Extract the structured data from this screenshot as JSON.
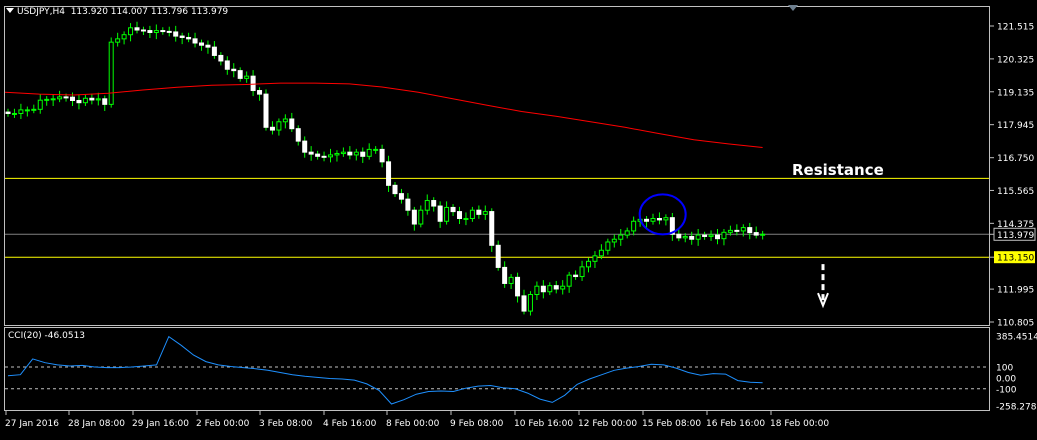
{
  "header": {
    "symbol": "USDJPY,H4",
    "ohlc": "113.920 114.007 113.796 113.979",
    "cci_label": "CCI(20) -46.0513"
  },
  "colors": {
    "background": "#000000",
    "grid": "#ffffff",
    "bull_candle": "#ffffff",
    "bear_candle": "#00ff00",
    "ma": "#ff0000",
    "level": "#ffff00",
    "cci": "#1e90ff",
    "circle": "#0000ff",
    "price_tag": "#ffff00"
  },
  "annotations": {
    "resistance_label": "Resistance",
    "levels": [
      "116.000",
      "113.150"
    ],
    "current_price": "113.979",
    "arrow": "down-arrow-icon",
    "circle": "blue-ellipse"
  },
  "chart_data": [
    {
      "type": "candlestick",
      "symbol": "USDJPY",
      "timeframe": "H4",
      "ylim": [
        110.805,
        121.515
      ],
      "y_ticks": [
        "121.515",
        "120.325",
        "119.135",
        "117.945",
        "116.750",
        "115.565",
        "114.375",
        "113.979",
        "113.150",
        "111.995",
        "110.805"
      ],
      "x_ticks": [
        "27 Jan 2016",
        "28 Jan 08:00",
        "29 Jan 16:00",
        "2 Feb 00:00",
        "3 Feb 08:00",
        "4 Feb 16:00",
        "8 Feb 00:00",
        "9 Feb 08:00",
        "10 Feb 16:00",
        "12 Feb 00:00",
        "15 Feb 08:00",
        "16 Feb 16:00",
        "18 Feb 00:00"
      ],
      "close_series": [
        118.35,
        118.35,
        118.48,
        118.48,
        118.5,
        118.83,
        118.86,
        118.88,
        118.95,
        118.94,
        118.82,
        118.74,
        118.9,
        118.84,
        118.88,
        118.68,
        120.93,
        121.05,
        121.2,
        121.45,
        121.37,
        121.35,
        121.28,
        121.35,
        121.32,
        121.3,
        121.15,
        121.1,
        121.05,
        120.9,
        120.82,
        120.75,
        120.45,
        120.25,
        119.95,
        119.9,
        119.62,
        119.7,
        119.18,
        119.05,
        117.85,
        117.75,
        118.05,
        118.15,
        117.8,
        117.35,
        116.95,
        116.88,
        116.8,
        116.78,
        116.85,
        116.9,
        116.95,
        116.85,
        116.95,
        116.8,
        117.05,
        117.05,
        116.6,
        115.75,
        115.45,
        115.25,
        114.85,
        114.35,
        114.85,
        115.2,
        115.0,
        114.45,
        114.95,
        114.8,
        114.55,
        114.55,
        114.85,
        114.7,
        114.8,
        113.58,
        112.78,
        112.2,
        112.42,
        111.75,
        111.2,
        111.8,
        112.1,
        111.9,
        112.12,
        112.0,
        112.1,
        112.5,
        112.45,
        112.8,
        113.0,
        113.2,
        113.4,
        113.7,
        113.8,
        113.95,
        114.1,
        114.45,
        114.52,
        114.45,
        114.55,
        114.5,
        114.58,
        113.98,
        113.85,
        113.9,
        113.8,
        113.95,
        113.9,
        113.95,
        113.82,
        114.05,
        114.12,
        114.1,
        114.22,
        114.04,
        113.95,
        113.98
      ],
      "moving_average": {
        "color": "#ff0000",
        "values": [
          119.12,
          119.05,
          119.02,
          119.08,
          119.2,
          119.3,
          119.37,
          119.4,
          119.45,
          119.45,
          119.42,
          119.3,
          119.12,
          118.88,
          118.65,
          118.42,
          118.25,
          118.05,
          117.85,
          117.62,
          117.4,
          117.25,
          117.12
        ]
      },
      "horizontal_levels": [
        {
          "value": 116.0,
          "label": "116.000",
          "color": "#ffff00"
        },
        {
          "value": 113.15,
          "label": "113.150",
          "color": "#ffff00"
        },
        {
          "value": 113.979,
          "label": "113.979",
          "color": "#808080"
        }
      ],
      "annotations": [
        "Resistance"
      ]
    },
    {
      "type": "line",
      "indicator": "CCI(20)",
      "current": -46.0513,
      "ylim": [
        -258.2783,
        385.4514
      ],
      "y_ticks": [
        "385.4514",
        "100",
        "0.00",
        "-100",
        "-258.2783"
      ],
      "levels": [
        100,
        -100
      ],
      "values": [
        20,
        30,
        175,
        140,
        120,
        110,
        115,
        100,
        95,
        95,
        100,
        110,
        120,
        380,
        300,
        210,
        150,
        120,
        105,
        95,
        85,
        70,
        50,
        30,
        15,
        5,
        -5,
        -10,
        -20,
        -55,
        -115,
        -240,
        -200,
        -150,
        -125,
        -120,
        -125,
        -95,
        -75,
        -70,
        -90,
        -100,
        -140,
        -195,
        -225,
        -160,
        -60,
        -10,
        30,
        70,
        90,
        105,
        125,
        120,
        90,
        50,
        25,
        40,
        35,
        -25,
        -40,
        -45
      ]
    }
  ]
}
